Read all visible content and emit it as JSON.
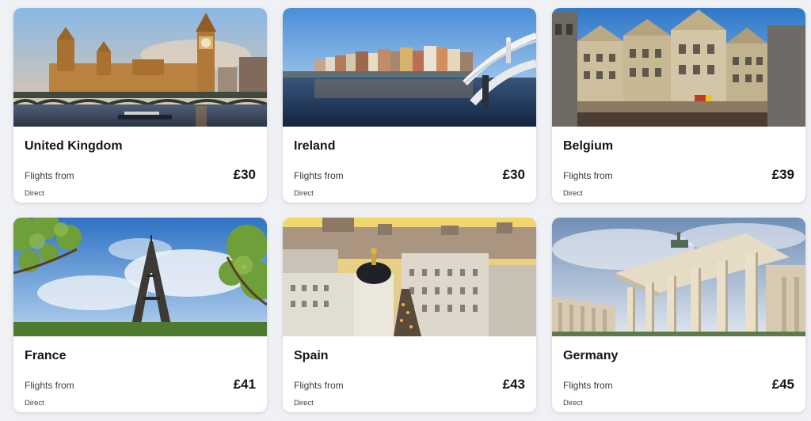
{
  "destinations": [
    {
      "country": "United Kingdom",
      "flights_from_label": "Flights from",
      "price": "£30",
      "stops": "Direct",
      "image_subject": "westminster-photo"
    },
    {
      "country": "Ireland",
      "flights_from_label": "Flights from",
      "price": "£30",
      "stops": "Direct",
      "image_subject": "dublin-river-photo"
    },
    {
      "country": "Belgium",
      "flights_from_label": "Flights from",
      "price": "£39",
      "stops": "Direct",
      "image_subject": "brussels-grand-place-photo"
    },
    {
      "country": "France",
      "flights_from_label": "Flights from",
      "price": "£41",
      "stops": "Direct",
      "image_subject": "eiffel-tower-photo"
    },
    {
      "country": "Spain",
      "flights_from_label": "Flights from",
      "price": "£43",
      "stops": "Direct",
      "image_subject": "madrid-skyline-photo"
    },
    {
      "country": "Germany",
      "flights_from_label": "Flights from",
      "price": "£45",
      "stops": "Direct",
      "image_subject": "brandenburg-gate-photo"
    }
  ],
  "colors": {
    "page_background": "#eff1f5",
    "card_background": "#ffffff",
    "text_primary": "#161616",
    "text_secondary": "#3d3d3d"
  }
}
